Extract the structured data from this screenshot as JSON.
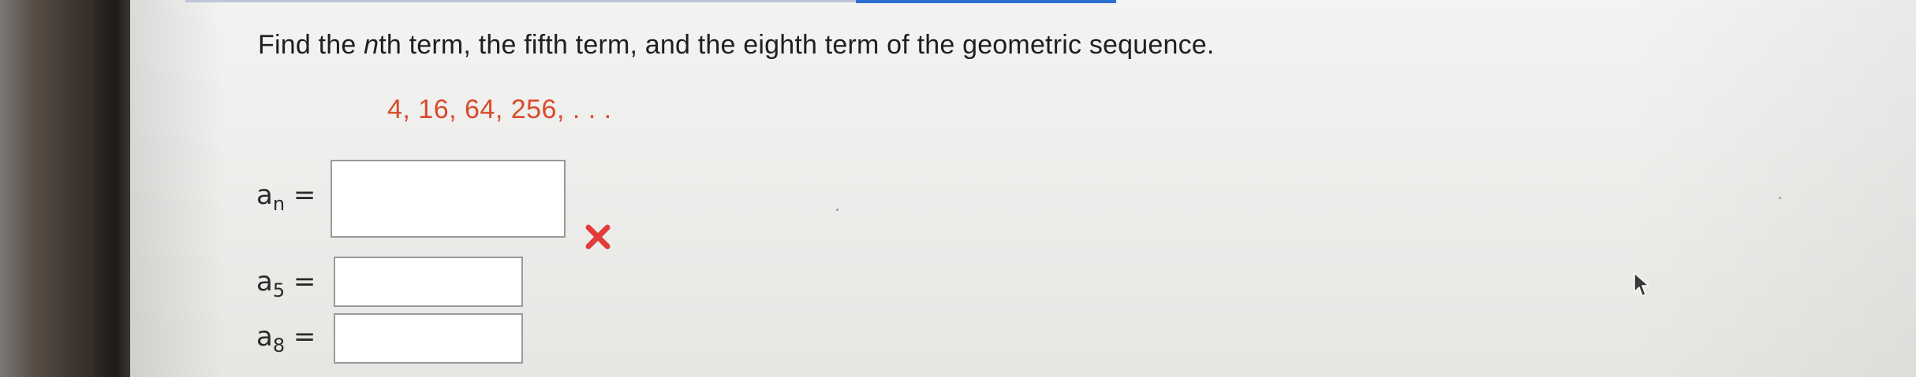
{
  "question": {
    "prefix": "Find the ",
    "variable": "n",
    "suffix": "th term, the fifth term, and the eighth term of the geometric sequence."
  },
  "sequence": "4, 16, 64, 256, . . .",
  "answers": [
    {
      "base": "a",
      "subscript": "n",
      "equals": " =",
      "value": ""
    },
    {
      "base": "a",
      "subscript": "5",
      "equals": " =",
      "value": ""
    },
    {
      "base": "a",
      "subscript": "8",
      "equals": " =",
      "value": ""
    }
  ],
  "status": {
    "an_icon": "cross-icon",
    "an_color": "#e23b3b"
  },
  "colors": {
    "sequence": "#d94a2b",
    "text": "#1f1f1f",
    "accent_bar": "#2f6fd0"
  }
}
